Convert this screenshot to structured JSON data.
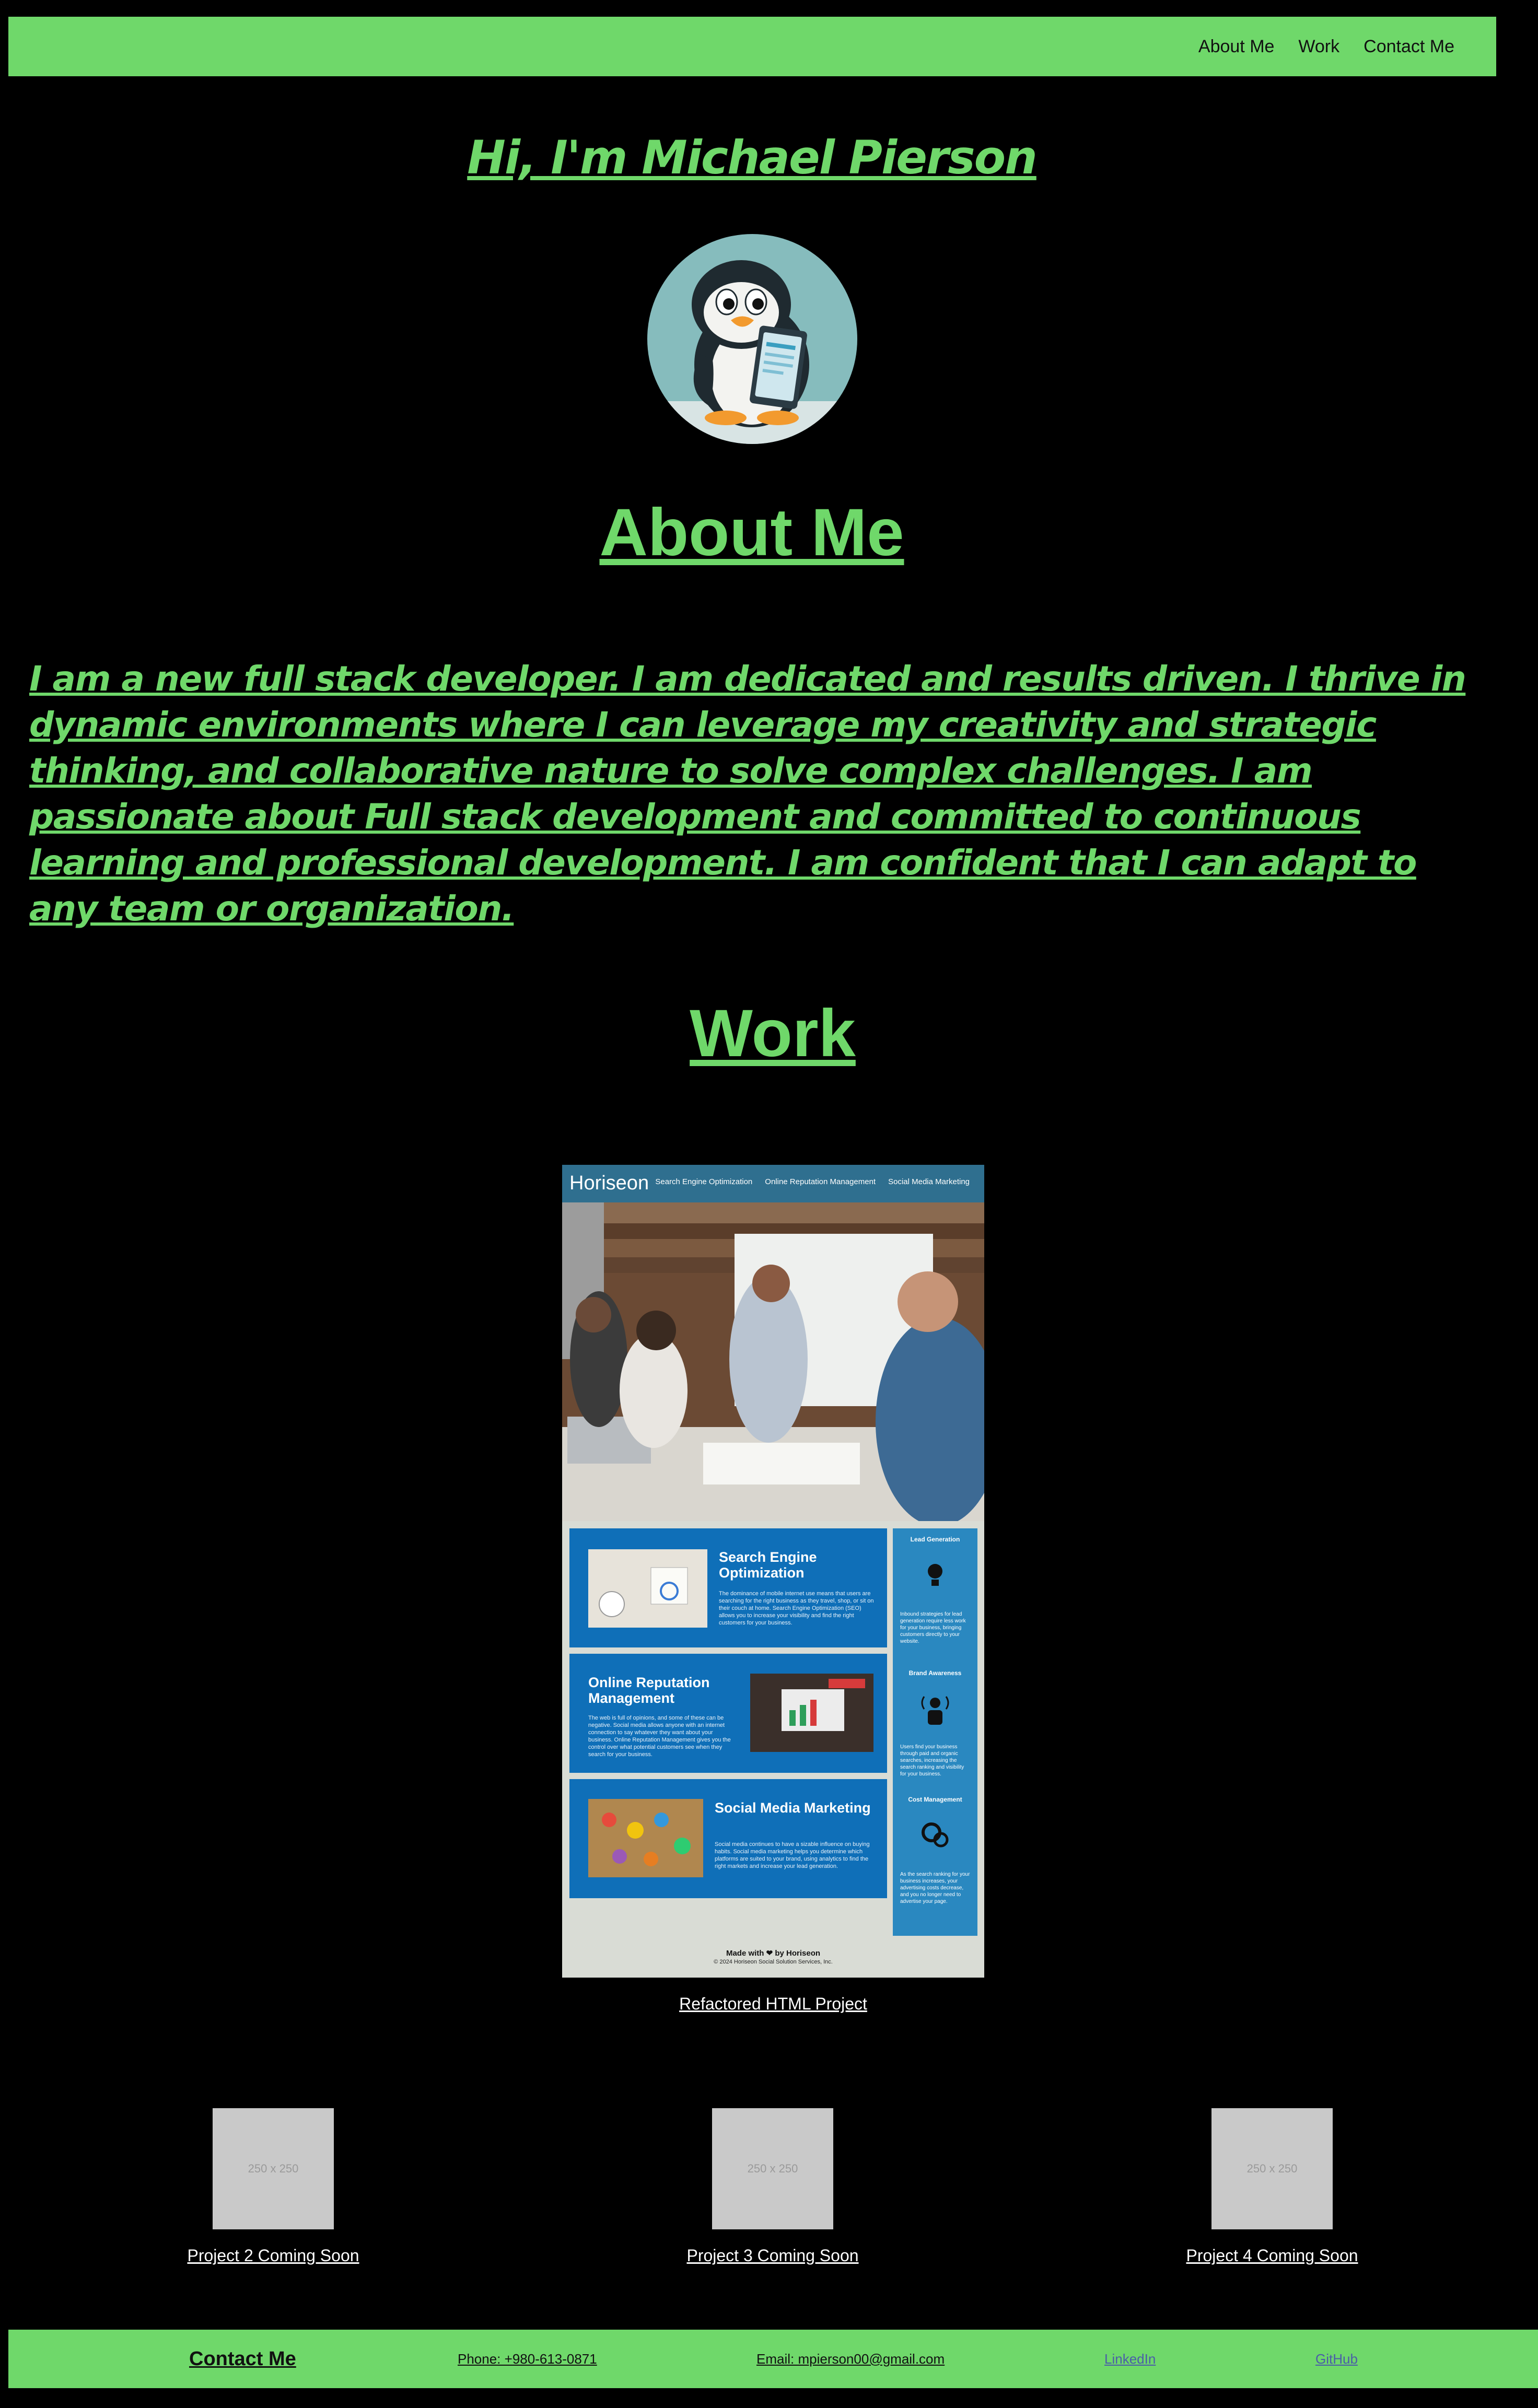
{
  "header": {
    "nav": [
      "About Me",
      "Work",
      "Contact Me"
    ]
  },
  "hero": {
    "title": "Hi, I'm Michael Pierson",
    "avatar_icon": "penguin-avatar-icon"
  },
  "about": {
    "heading": "About Me",
    "text": "I am a new full stack developer. I am dedicated and results driven. I thrive in dynamic environments where I can leverage my creativity and strategic thinking, and collaborative nature to solve complex challenges. I am passionate about Full stack development and committed to continuous learning and professional development. I am confident that I can adapt to any team or organization."
  },
  "work": {
    "heading": "Work",
    "featured": {
      "caption": "Refactored HTML Project",
      "screenshot": {
        "logo": "Horiseon",
        "nav": [
          "Search Engine Optimization",
          "Online Reputation Management",
          "Social Media Marketing"
        ],
        "cards": [
          {
            "title": "Search Engine Optimization",
            "body": "The dominance of mobile internet use means that users are searching for the right business as they travel, shop, or sit on their couch at home. Search Engine Optimization (SEO) allows you to increase your visibility and find the right customers for your business."
          },
          {
            "title": "Online Reputation Management",
            "body": "The web is full of opinions, and some of these can be negative. Social media allows anyone with an internet connection to say whatever they want about your business. Online Reputation Management gives you the control over what potential customers see when they search for your business."
          },
          {
            "title": "Social Media Marketing",
            "body": "Social media continues to have a sizable influence on buying habits. Social media marketing helps you determine which platforms are suited to your brand, using analytics to find the right markets and increase your lead generation."
          }
        ],
        "benefits": [
          {
            "title": "Lead Generation",
            "body": "Inbound strategies for lead generation require less work for your business, bringing customers directly to your website."
          },
          {
            "title": "Brand Awareness",
            "body": "Users find your business through paid and organic searches, increasing the search ranking and visibility for your business."
          },
          {
            "title": "Cost Management",
            "body": "As the search ranking for your business increases, your advertising costs decrease, and you no longer need to advertise your page."
          }
        ],
        "footer_made": "Made with ❤ by Horiseon",
        "footer_copy": "© 2024 Horiseon Social Solution Services, Inc."
      }
    },
    "projects": [
      {
        "placeholder": "250 x 250",
        "caption": "Project 2 Coming Soon"
      },
      {
        "placeholder": "250 x 250",
        "caption": "Project 3 Coming Soon"
      },
      {
        "placeholder": "250 x 250",
        "caption": "Project 4 Coming Soon"
      }
    ]
  },
  "footer": {
    "contact": "Contact Me",
    "phone": "Phone: +980-613-0871",
    "email": "Email: mpierson00@gmail.com",
    "linkedin": "LinkedIn",
    "github": "GitHub"
  },
  "colors": {
    "accent": "#6fd86a",
    "background": "#000000"
  }
}
